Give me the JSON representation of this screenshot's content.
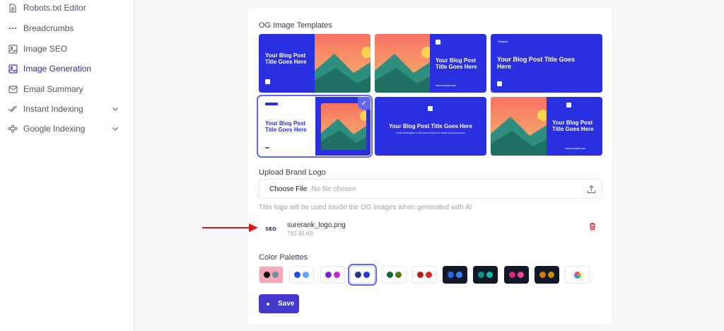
{
  "sidebar": {
    "items": [
      {
        "label": "Robots.txt Editor",
        "icon": "document-icon"
      },
      {
        "label": "Breadcrumbs",
        "icon": "dots-icon"
      },
      {
        "label": "Image SEO",
        "icon": "image-icon"
      },
      {
        "label": "Image Generation",
        "icon": "image-generation-icon",
        "active": true
      },
      {
        "label": "Email Summary",
        "icon": "mail-icon"
      },
      {
        "label": "Instant Indexing",
        "icon": "double-check-icon",
        "expandable": true
      },
      {
        "label": "Google Indexing",
        "icon": "network-icon",
        "expandable": true
      }
    ]
  },
  "og": {
    "section_label": "OG Image Templates",
    "templates": [
      {
        "title": "Your Blog Post Title Goes Here"
      },
      {
        "title": "Your Blog Post Title Goes Here",
        "url": "www.example.com"
      },
      {
        "title": "Your Blog Post Title Goes Here",
        "badge": "Category"
      },
      {
        "title": "Your Blog Post Title Goes Here",
        "selected": true
      },
      {
        "title": "Your Blog Post Title Goes Here",
        "subtitle": "A brief description of the post content for social sharing preview."
      },
      {
        "title": "Your Blog Post Title Goes Here",
        "url": "www.example.com"
      }
    ]
  },
  "upload": {
    "section_label": "Upload Brand Logo",
    "choose_label": "Choose File",
    "no_file_label": "No file chosen",
    "hint": "This logo will be used inside the OG images when generated with AI",
    "file_name": "surerank_logo.png",
    "file_size": "782.46 KB",
    "thumb_text": "SEO"
  },
  "palettes": {
    "section_label": "Color Palettes",
    "items": [
      {
        "colors": [
          "#111111",
          "#6b8fa3"
        ],
        "bg": "#f9a8b8"
      },
      {
        "colors": [
          "#1d4ed8",
          "#60a5fa"
        ],
        "bg": "#ffffff"
      },
      {
        "colors": [
          "#7e22ce",
          "#c026d3"
        ],
        "bg": "#ffffff"
      },
      {
        "colors": [
          "#1e3a8a",
          "#2a2fe0"
        ],
        "bg": "#ffffff",
        "selected": true
      },
      {
        "colors": [
          "#166534",
          "#4d7c0f"
        ],
        "bg": "#ffffff"
      },
      {
        "colors": [
          "#b91c1c",
          "#dc2626"
        ],
        "bg": "#ffffff"
      },
      {
        "colors": [
          "#2563eb",
          "#3b82f6"
        ],
        "bg": "#111827"
      },
      {
        "colors": [
          "#0d9488",
          "#14b8a6"
        ],
        "bg": "#111827"
      },
      {
        "colors": [
          "#db2777",
          "#ec4899"
        ],
        "bg": "#111827"
      },
      {
        "colors": [
          "#d97706",
          "#ca8a04"
        ],
        "bg": "#111827"
      }
    ]
  },
  "save_label": "Save",
  "accent_color": "#4338ca"
}
